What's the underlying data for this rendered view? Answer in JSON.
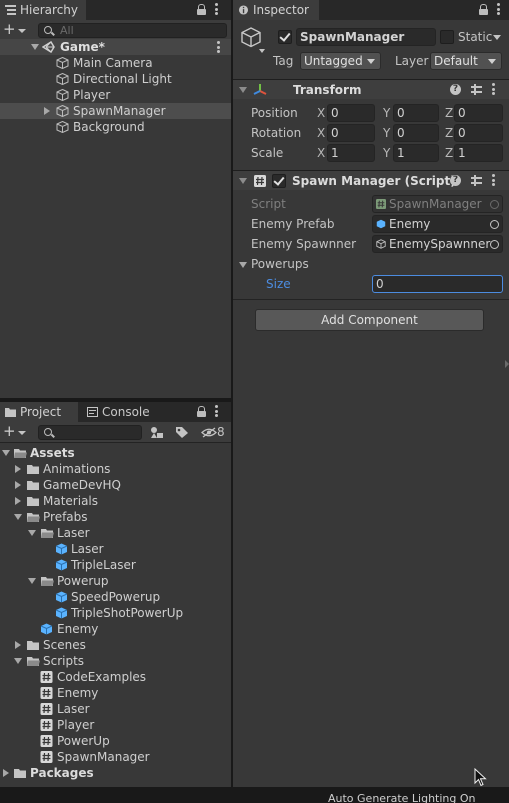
{
  "hierarchy": {
    "tab_label": "Hierarchy",
    "search_placeholder": "All",
    "scene_name": "Game*",
    "items": [
      {
        "label": "Main Camera"
      },
      {
        "label": "Directional Light"
      },
      {
        "label": "Player"
      },
      {
        "label": "SpawnManager"
      },
      {
        "label": "Background"
      }
    ]
  },
  "inspector": {
    "tab_label": "Inspector",
    "object_name": "SpawnManager",
    "static_label": "Static",
    "tag_label": "Tag",
    "tag_value": "Untagged",
    "layer_label": "Layer",
    "layer_value": "Default",
    "transform": {
      "title": "Transform",
      "rows": [
        {
          "label": "Position",
          "x": "0",
          "y": "0",
          "z": "0"
        },
        {
          "label": "Rotation",
          "x": "0",
          "y": "0",
          "z": "0"
        },
        {
          "label": "Scale",
          "x": "1",
          "y": "1",
          "z": "1"
        }
      ],
      "axis": {
        "x": "X",
        "y": "Y",
        "z": "Z"
      }
    },
    "script_component": {
      "title": "Spawn Manager (Script)",
      "script_label": "Script",
      "script_value": "SpawnManager",
      "enemy_prefab_label": "Enemy Prefab",
      "enemy_prefab_value": "Enemy",
      "enemy_spawner_label": "Enemy Spawnner",
      "enemy_spawner_value": "EnemySpawnner",
      "powerups_label": "Powerups",
      "size_label": "Size",
      "size_value": "0"
    },
    "add_component_label": "Add Component"
  },
  "project": {
    "project_tab_label": "Project",
    "console_tab_label": "Console",
    "hidden_count": "8",
    "tree": {
      "assets": "Assets",
      "animations": "Animations",
      "gamedevhq": "GameDevHQ",
      "materials": "Materials",
      "prefabs": "Prefabs",
      "laser_folder": "Laser",
      "laser": "Laser",
      "triple_laser": "TripleLaser",
      "powerup_folder": "Powerup",
      "speed_powerup": "SpeedPowerup",
      "triple_shot": "TripleShotPowerUp",
      "enemy": "Enemy",
      "scenes": "Scenes",
      "scripts": "Scripts",
      "code_examples": "CodeExamples",
      "s_enemy": "Enemy",
      "s_laser": "Laser",
      "s_player": "Player",
      "s_powerup": "PowerUp",
      "s_spawnmanager": "SpawnManager",
      "packages": "Packages"
    }
  },
  "status_bar": {
    "text": "Auto Generate Lighting On"
  },
  "colors": {
    "panel_bg": "#383838",
    "selection": "#4d4d4d",
    "field_bg": "#2a2a2a",
    "accent_blue": "#4c8ce0",
    "folder": "#c4c4c4",
    "prefab": "#5ab3ff"
  }
}
